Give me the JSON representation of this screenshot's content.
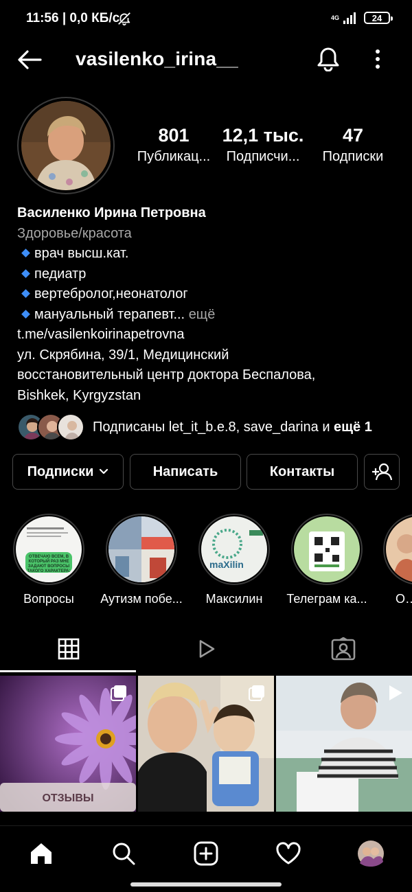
{
  "status_bar": {
    "time_speed": "11:56 | 0,0 КБ/с",
    "network": "4G",
    "battery": "24"
  },
  "header": {
    "username": "vasilenko_irina__"
  },
  "stats": [
    {
      "value": "801",
      "label": "Публикац..."
    },
    {
      "value": "12,1 тыс.",
      "label": "Подписчи..."
    },
    {
      "value": "47",
      "label": "Подписки"
    }
  ],
  "bio": {
    "name": "Василенко Ирина Петровна",
    "category": "Здоровье/красота",
    "lines": [
      "врач высш.кат.",
      "педиатр",
      "вертебролог,неонатолог",
      "мануальный терапевт..."
    ],
    "more": "ещё",
    "link": "t.me/vasilenkoirinapetrovna",
    "address_1": "ул. Скрябина,  39/1, Медицинский",
    "address_2": "восстановительный центр доктора Беспалова,",
    "address_3": "Bishkek, Kyrgyzstan"
  },
  "followed_by": {
    "prefix": "Подписаны let_it_b.e.8, save_darina и ",
    "bold": "ещё 1"
  },
  "actions": {
    "following": "Подписки",
    "message": "Написать",
    "contacts": "Контакты"
  },
  "highlights": [
    {
      "label": "Вопросы",
      "caption": "ОТВЕЧАЮ ВСЕМ, В КОТОРЫЙ РАЗ МНЕ ЗАДАЮТ ВОПРОСЫ ТАКОГО ХАРАКТЕРА:"
    },
    {
      "label": "Аутизм побе..."
    },
    {
      "label": "Максилин",
      "caption": "maXilin"
    },
    {
      "label": "Телеграм ка..."
    },
    {
      "label": "Отз..."
    }
  ],
  "grid": {
    "first_caption": "ОТЗЫВЫ"
  },
  "colors": {
    "background": "#000000",
    "text": "#ffffff",
    "secondary_text": "#a8a8a8",
    "bio_bullet": "#3e8ef7",
    "border": "#4a4a4a"
  },
  "icons": [
    "back-arrow-icon",
    "bell-icon",
    "more-vertical-icon",
    "chevron-down-icon",
    "add-user-icon",
    "grid-icon",
    "reels-play-icon",
    "tagged-icon",
    "home-icon",
    "search-icon",
    "plus-square-icon",
    "heart-icon",
    "profile-avatar-icon"
  ]
}
